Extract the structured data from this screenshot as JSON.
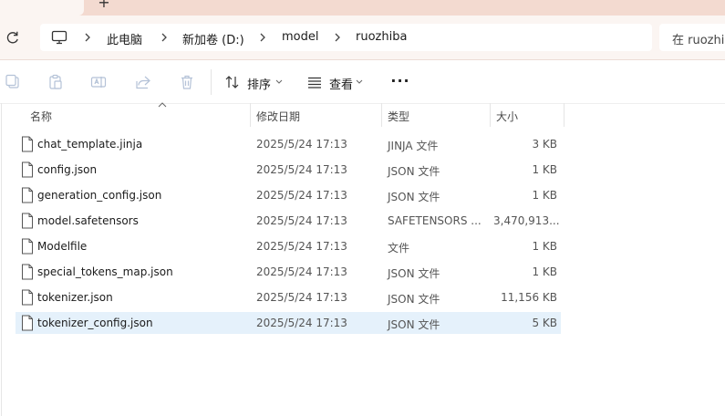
{
  "tabbar": {
    "new_tab": "+"
  },
  "address": {
    "crumbs": [
      "此电脑",
      "新加卷 (D:)",
      "model",
      "ruozhiba"
    ]
  },
  "search": {
    "placeholder": "在 ruozhiba 中搜索"
  },
  "toolbar": {
    "sort_label": "排序",
    "view_label": "查看",
    "more_label": "···"
  },
  "columns": {
    "name": "名称",
    "modified": "修改日期",
    "type": "类型",
    "size": "大小"
  },
  "files": [
    {
      "name": "chat_template.jinja",
      "modified": "2025/5/24 17:13",
      "type": "JINJA 文件",
      "size": "3 KB"
    },
    {
      "name": "config.json",
      "modified": "2025/5/24 17:13",
      "type": "JSON 文件",
      "size": "1 KB"
    },
    {
      "name": "generation_config.json",
      "modified": "2025/5/24 17:13",
      "type": "JSON 文件",
      "size": "1 KB"
    },
    {
      "name": "model.safetensors",
      "modified": "2025/5/24 17:13",
      "type": "SAFETENSORS ...",
      "size": "3,470,913..."
    },
    {
      "name": "Modelfile",
      "modified": "2025/5/24 17:13",
      "type": "文件",
      "size": "1 KB"
    },
    {
      "name": "special_tokens_map.json",
      "modified": "2025/5/24 17:13",
      "type": "JSON 文件",
      "size": "1 KB"
    },
    {
      "name": "tokenizer.json",
      "modified": "2025/5/24 17:13",
      "type": "JSON 文件",
      "size": "11,156 KB"
    },
    {
      "name": "tokenizer_config.json",
      "modified": "2025/5/24 17:13",
      "type": "JSON 文件",
      "size": "5 KB"
    }
  ],
  "colors": {
    "selection": "#e5f1fb",
    "chrome": "#fbf5f2",
    "tabstrip": "#f3dad0"
  }
}
